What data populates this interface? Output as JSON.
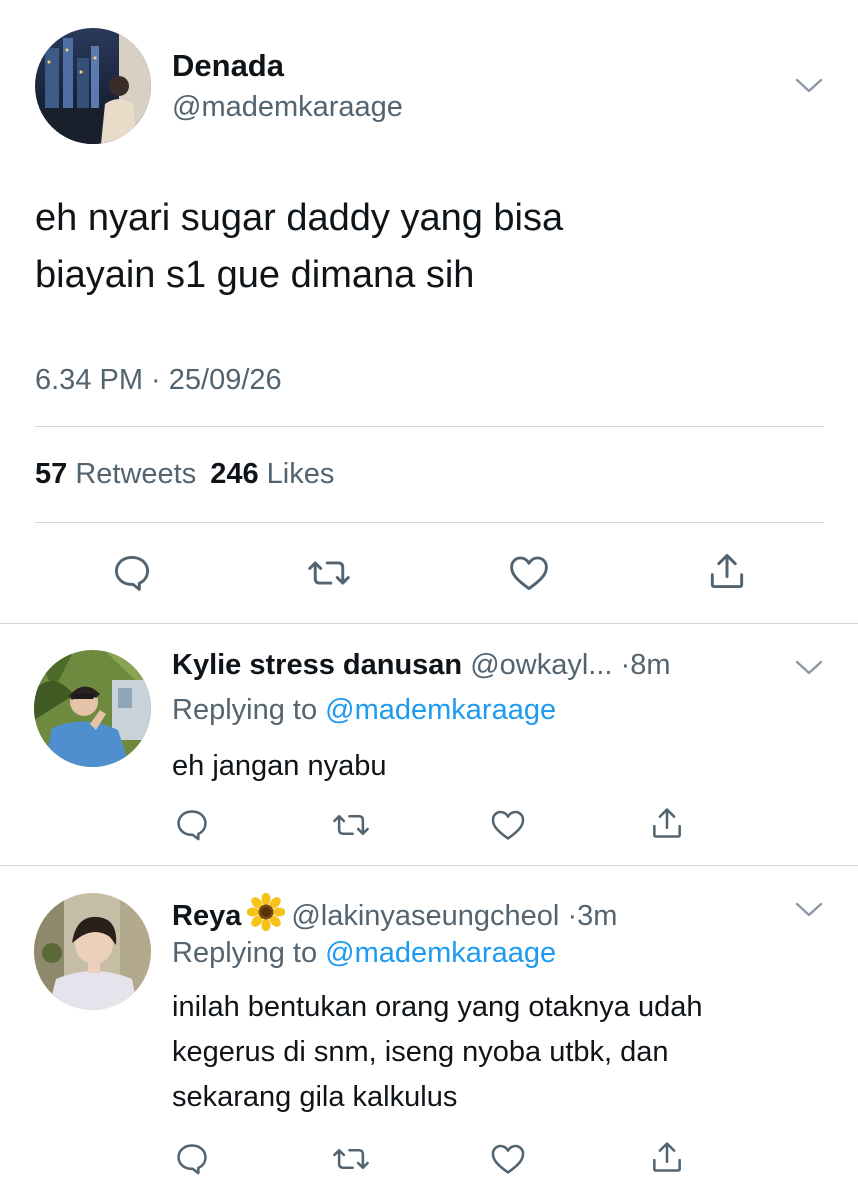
{
  "main": {
    "name": "Denada",
    "handle": "@mademkaraage",
    "text_line1": "eh nyari sugar daddy yang bisa",
    "text_line2": "biayain s1 gue dimana sih",
    "timestamp": "6.34 PM · 25/09/26",
    "retweets_count": "57",
    "retweets_label": "Retweets",
    "likes_count": "246",
    "likes_label": "Likes"
  },
  "replies": [
    {
      "name": "Kylie stress danusan",
      "handle": "@owkayl...",
      "time": "·8m",
      "replying_prefix": "Replying to",
      "replying_handle": "@mademkaraage",
      "text": "eh jangan nyabu"
    },
    {
      "name": "Reya",
      "handle": "@lakinyaseungcheol",
      "time": "·3m",
      "replying_prefix": "Replying to",
      "replying_handle": "@mademkaraage",
      "text_line1": "inilah bentukan orang yang otaknya udah",
      "text_line2": "kegerus di snm, iseng nyoba utbk, dan",
      "text_line3": "sekarang gila kalkulus"
    }
  ],
  "icons": {
    "reply": "speech-bubble-icon",
    "retweet": "retweet-icon",
    "like": "heart-icon",
    "share": "share-icon",
    "more": "chevron-down-icon",
    "emoji": "sunflower-emoji"
  },
  "colors": {
    "text": "#0f1419",
    "secondary": "#536471",
    "link": "#1d9bf0",
    "divider": "#cfd9de"
  }
}
